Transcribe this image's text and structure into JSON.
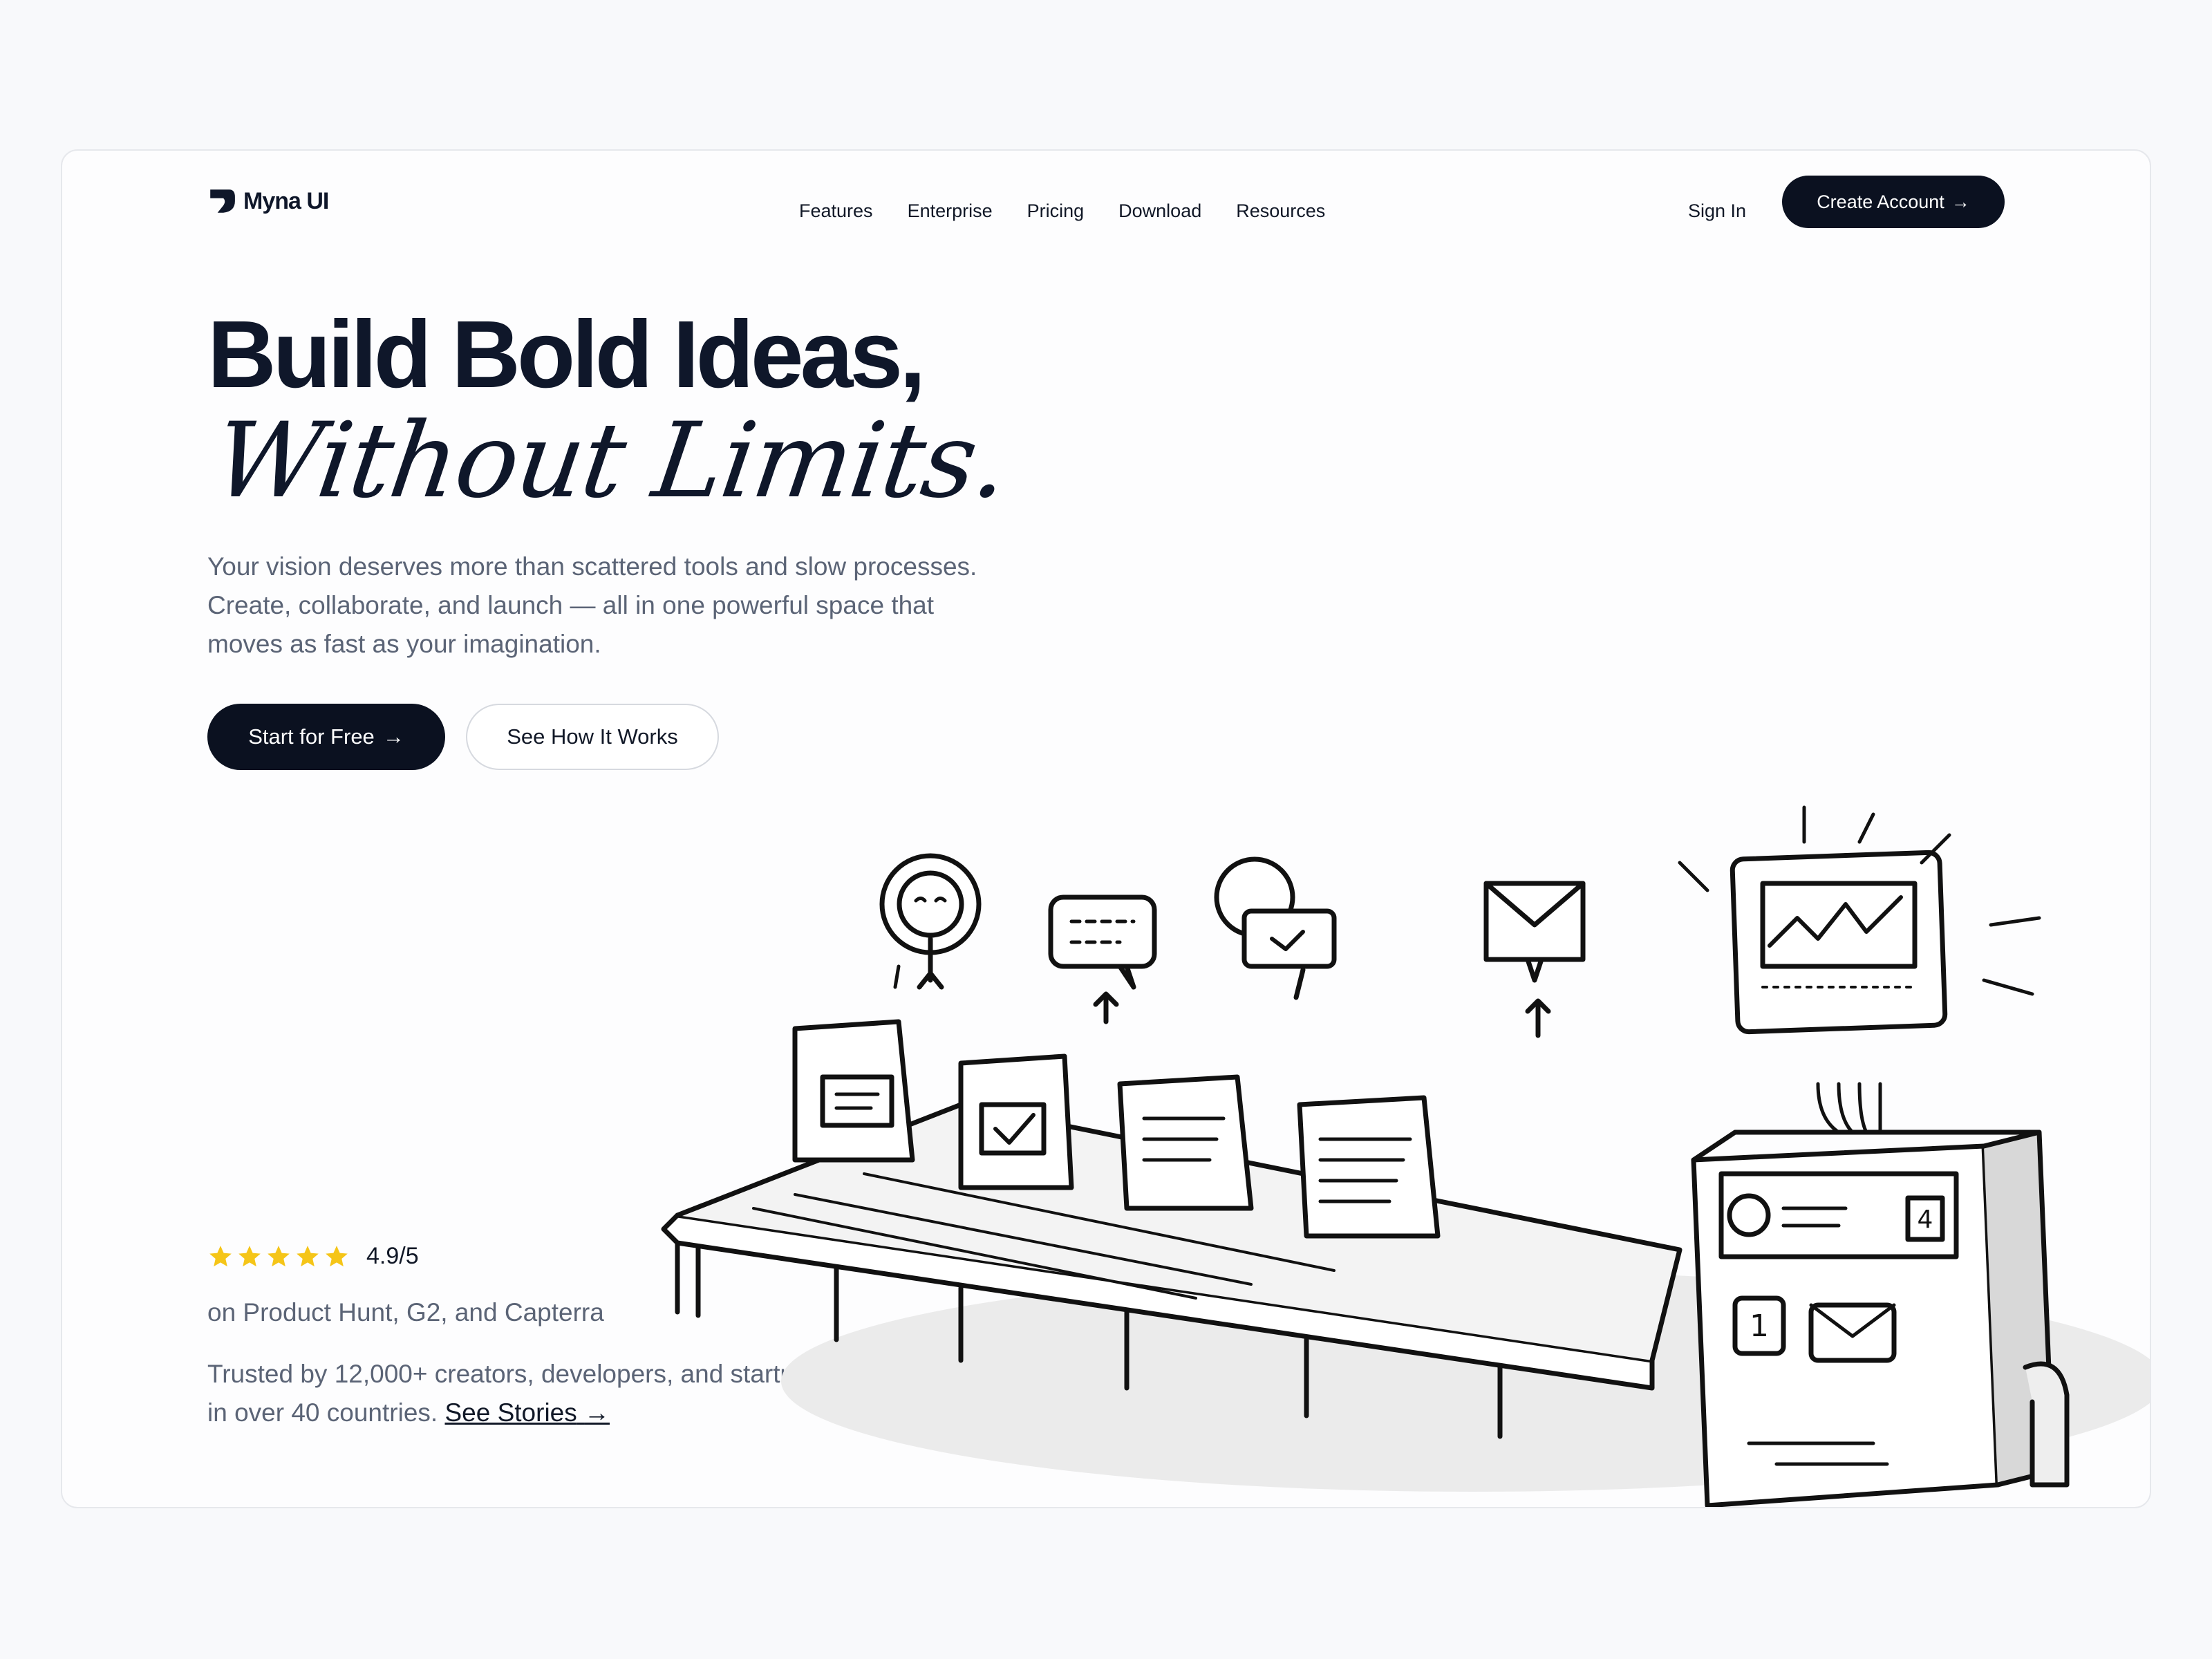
{
  "brand": {
    "name": "Myna UI",
    "logo_icon": "myna-logo-icon"
  },
  "nav": {
    "links": [
      "Features",
      "Enterprise",
      "Pricing",
      "Download",
      "Resources"
    ],
    "sign_in": "Sign In",
    "create_account": "Create Account",
    "arrow": "→"
  },
  "hero": {
    "title": "Build Bold Ideas,",
    "script": "Without Limits.",
    "description": "Your vision deserves more than scattered tools and slow processes. Create, collaborate, and launch — all in one powerful space that moves as fast as your imagination.",
    "cta_primary": "Start for Free",
    "cta_secondary": "See How It Works",
    "arrow": "→"
  },
  "rating": {
    "stars": 5,
    "value": "4.9/5",
    "source": "on Product Hunt, G2, and Capterra",
    "star_color": "#f5c518"
  },
  "trust": {
    "text": "Trusted by 12,000+ creators, developers, and startups in over 40 countries.",
    "link": "See Stories",
    "arrow": "→"
  },
  "illustration": {
    "name": "conveyor-machine-illustration",
    "machine_dial_number": "1",
    "machine_counter": "4"
  },
  "colors": {
    "primary": "#0b1120",
    "muted_text": "#5b6476",
    "background": "#f8f9fb"
  }
}
